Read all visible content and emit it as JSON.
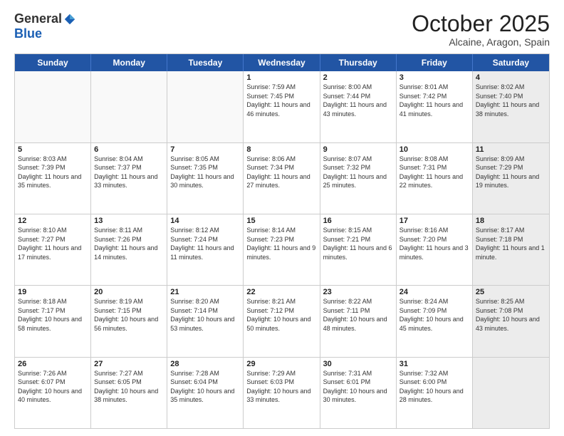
{
  "logo": {
    "general": "General",
    "blue": "Blue"
  },
  "title": "October 2025",
  "location": "Alcaine, Aragon, Spain",
  "days_of_week": [
    "Sunday",
    "Monday",
    "Tuesday",
    "Wednesday",
    "Thursday",
    "Friday",
    "Saturday"
  ],
  "weeks": [
    [
      {
        "day": "",
        "empty": true
      },
      {
        "day": "",
        "empty": true
      },
      {
        "day": "",
        "empty": true
      },
      {
        "day": "1",
        "sunrise": "7:59 AM",
        "sunset": "7:45 PM",
        "daylight": "11 hours and 46 minutes."
      },
      {
        "day": "2",
        "sunrise": "8:00 AM",
        "sunset": "7:44 PM",
        "daylight": "11 hours and 43 minutes."
      },
      {
        "day": "3",
        "sunrise": "8:01 AM",
        "sunset": "7:42 PM",
        "daylight": "11 hours and 41 minutes."
      },
      {
        "day": "4",
        "sunrise": "8:02 AM",
        "sunset": "7:40 PM",
        "daylight": "11 hours and 38 minutes.",
        "shaded": true
      }
    ],
    [
      {
        "day": "5",
        "sunrise": "8:03 AM",
        "sunset": "7:39 PM",
        "daylight": "11 hours and 35 minutes."
      },
      {
        "day": "6",
        "sunrise": "8:04 AM",
        "sunset": "7:37 PM",
        "daylight": "11 hours and 33 minutes."
      },
      {
        "day": "7",
        "sunrise": "8:05 AM",
        "sunset": "7:35 PM",
        "daylight": "11 hours and 30 minutes."
      },
      {
        "day": "8",
        "sunrise": "8:06 AM",
        "sunset": "7:34 PM",
        "daylight": "11 hours and 27 minutes."
      },
      {
        "day": "9",
        "sunrise": "8:07 AM",
        "sunset": "7:32 PM",
        "daylight": "11 hours and 25 minutes."
      },
      {
        "day": "10",
        "sunrise": "8:08 AM",
        "sunset": "7:31 PM",
        "daylight": "11 hours and 22 minutes."
      },
      {
        "day": "11",
        "sunrise": "8:09 AM",
        "sunset": "7:29 PM",
        "daylight": "11 hours and 19 minutes.",
        "shaded": true
      }
    ],
    [
      {
        "day": "12",
        "sunrise": "8:10 AM",
        "sunset": "7:27 PM",
        "daylight": "11 hours and 17 minutes."
      },
      {
        "day": "13",
        "sunrise": "8:11 AM",
        "sunset": "7:26 PM",
        "daylight": "11 hours and 14 minutes."
      },
      {
        "day": "14",
        "sunrise": "8:12 AM",
        "sunset": "7:24 PM",
        "daylight": "11 hours and 11 minutes."
      },
      {
        "day": "15",
        "sunrise": "8:14 AM",
        "sunset": "7:23 PM",
        "daylight": "11 hours and 9 minutes."
      },
      {
        "day": "16",
        "sunrise": "8:15 AM",
        "sunset": "7:21 PM",
        "daylight": "11 hours and 6 minutes."
      },
      {
        "day": "17",
        "sunrise": "8:16 AM",
        "sunset": "7:20 PM",
        "daylight": "11 hours and 3 minutes."
      },
      {
        "day": "18",
        "sunrise": "8:17 AM",
        "sunset": "7:18 PM",
        "daylight": "11 hours and 1 minute.",
        "shaded": true
      }
    ],
    [
      {
        "day": "19",
        "sunrise": "8:18 AM",
        "sunset": "7:17 PM",
        "daylight": "10 hours and 58 minutes."
      },
      {
        "day": "20",
        "sunrise": "8:19 AM",
        "sunset": "7:15 PM",
        "daylight": "10 hours and 56 minutes."
      },
      {
        "day": "21",
        "sunrise": "8:20 AM",
        "sunset": "7:14 PM",
        "daylight": "10 hours and 53 minutes."
      },
      {
        "day": "22",
        "sunrise": "8:21 AM",
        "sunset": "7:12 PM",
        "daylight": "10 hours and 50 minutes."
      },
      {
        "day": "23",
        "sunrise": "8:22 AM",
        "sunset": "7:11 PM",
        "daylight": "10 hours and 48 minutes."
      },
      {
        "day": "24",
        "sunrise": "8:24 AM",
        "sunset": "7:09 PM",
        "daylight": "10 hours and 45 minutes."
      },
      {
        "day": "25",
        "sunrise": "8:25 AM",
        "sunset": "7:08 PM",
        "daylight": "10 hours and 43 minutes.",
        "shaded": true
      }
    ],
    [
      {
        "day": "26",
        "sunrise": "7:26 AM",
        "sunset": "6:07 PM",
        "daylight": "10 hours and 40 minutes."
      },
      {
        "day": "27",
        "sunrise": "7:27 AM",
        "sunset": "6:05 PM",
        "daylight": "10 hours and 38 minutes."
      },
      {
        "day": "28",
        "sunrise": "7:28 AM",
        "sunset": "6:04 PM",
        "daylight": "10 hours and 35 minutes."
      },
      {
        "day": "29",
        "sunrise": "7:29 AM",
        "sunset": "6:03 PM",
        "daylight": "10 hours and 33 minutes."
      },
      {
        "day": "30",
        "sunrise": "7:31 AM",
        "sunset": "6:01 PM",
        "daylight": "10 hours and 30 minutes."
      },
      {
        "day": "31",
        "sunrise": "7:32 AM",
        "sunset": "6:00 PM",
        "daylight": "10 hours and 28 minutes."
      },
      {
        "day": "",
        "empty": true,
        "shaded": true
      }
    ]
  ]
}
